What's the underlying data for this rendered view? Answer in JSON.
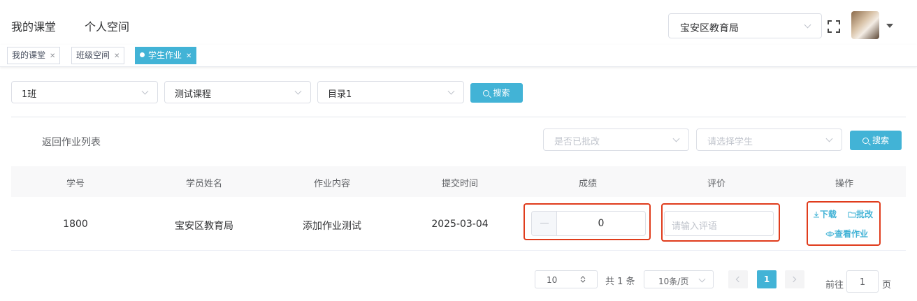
{
  "topnav": {
    "items": [
      "我的课堂",
      "个人空间"
    ],
    "org_select": "宝安区教育局"
  },
  "tags": [
    {
      "label": "我的课堂",
      "active": false
    },
    {
      "label": "班级空间",
      "active": false
    },
    {
      "label": "学生作业",
      "active": true
    }
  ],
  "filters": {
    "class": "1班",
    "course": "测试课程",
    "catalog": "目录1",
    "search_label": "搜索"
  },
  "list_filters": {
    "back_label": "返回作业列表",
    "reviewed_placeholder": "是否已批改",
    "student_placeholder": "请选择学生",
    "search_label": "搜索"
  },
  "table": {
    "columns": [
      "学号",
      "学员姓名",
      "作业内容",
      "提交时间",
      "成绩",
      "评价",
      "操作"
    ],
    "rows": [
      {
        "id": "1800",
        "name": "宝安区教育局",
        "content": "添加作业测试",
        "time": "2025-03-04",
        "score": "0",
        "comment_placeholder": "请输入评语",
        "actions": {
          "download": "下载",
          "review": "批改",
          "view": "查看作业"
        }
      }
    ]
  },
  "pagination": {
    "page_size_input": "10",
    "total": "共 1 条",
    "page_size_select": "10条/页",
    "current_page": "1",
    "goto_prefix": "前往",
    "goto_value": "1",
    "goto_suffix": "页"
  },
  "colors": {
    "accent": "#42b3d6",
    "highlight": "#e03c1c"
  }
}
